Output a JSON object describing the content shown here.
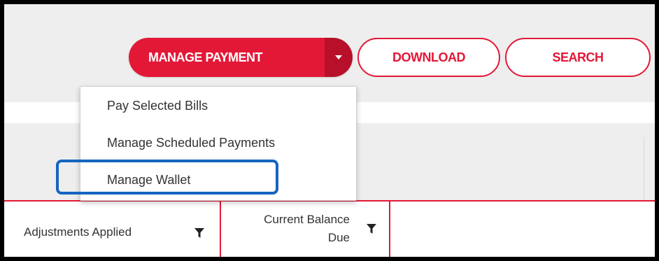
{
  "toolbar": {
    "manage_payment_label": "MANAGE PAYMENT",
    "download_label": "DOWNLOAD",
    "search_label": "SEARCH"
  },
  "dropdown": {
    "items": [
      {
        "label": "Pay Selected Bills"
      },
      {
        "label": "Manage Scheduled Payments"
      },
      {
        "label": "Manage Wallet"
      }
    ]
  },
  "table": {
    "columns": [
      {
        "label": "Adjustments Applied"
      },
      {
        "label": "Current Balance Due",
        "line1": "Current Balance",
        "line2": "Due"
      }
    ]
  },
  "colors": {
    "brand_red": "#e31837",
    "brand_red_dark": "#b8102a",
    "highlight_blue": "#1565c0"
  },
  "icons": [
    "chevron-down-icon",
    "filter-icon"
  ]
}
